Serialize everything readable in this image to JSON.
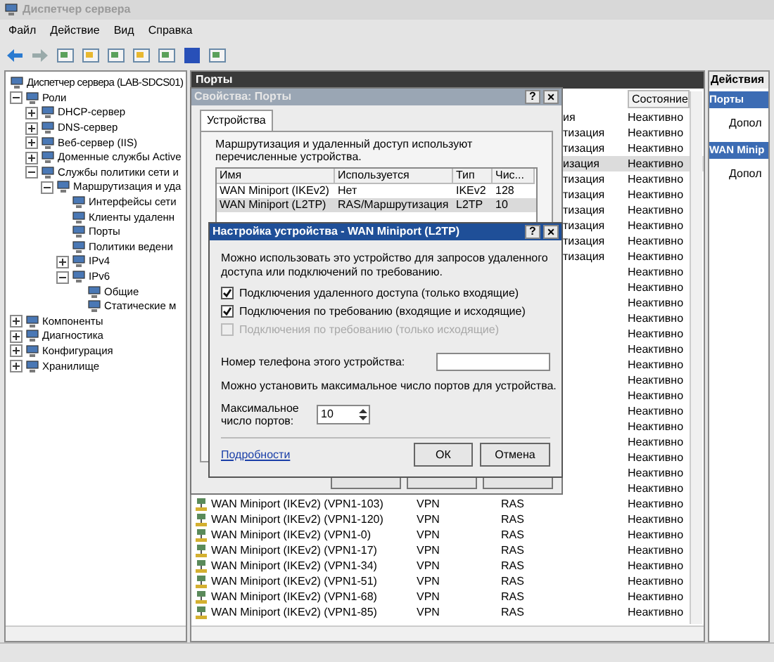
{
  "window": {
    "title": "Диспетчер сервера"
  },
  "menu": [
    "Файл",
    "Действие",
    "Вид",
    "Справка"
  ],
  "tree": [
    {
      "label": "Диспетчер сервера (LAB-SDCS01)"
    },
    {
      "label": "Роли",
      "expanded": true,
      "children": [
        {
          "label": "DHCP-сервер",
          "expanded": false
        },
        {
          "label": "DNS-сервер",
          "expanded": false
        },
        {
          "label": "Веб-сервер (IIS)",
          "expanded": false
        },
        {
          "label": "Доменные службы Active",
          "expanded": false
        },
        {
          "label": "Службы политики сети и",
          "expanded": true,
          "children": [
            {
              "label": "Маршрутизация и уда",
              "expanded": true,
              "children": [
                {
                  "label": "Интерфейсы сети"
                },
                {
                  "label": "Клиенты удаленн"
                },
                {
                  "label": "Порты"
                },
                {
                  "label": "Политики ведени"
                },
                {
                  "label": "IPv4",
                  "expanded": false
                },
                {
                  "label": "IPv6",
                  "expanded": true,
                  "children": [
                    {
                      "label": "Общие"
                    },
                    {
                      "label": "Статические м"
                    }
                  ]
                }
              ]
            }
          ]
        }
      ]
    },
    {
      "label": "Компоненты",
      "expanded": false
    },
    {
      "label": "Диагностика",
      "expanded": false
    },
    {
      "label": "Конфигурация",
      "expanded": false
    },
    {
      "label": "Хранилище",
      "expanded": false
    }
  ],
  "content": {
    "title": "Порты",
    "status_header": "Состояние",
    "rows": [
      {
        "kind": "partial",
        "column_3": "ия",
        "status": "Неактивно",
        "selected": false
      },
      {
        "kind": "partial",
        "column_3": "тизация",
        "status": "Неактивно",
        "selected": false
      },
      {
        "kind": "partial",
        "column_3": "тизация",
        "status": "Неактивно",
        "selected": false
      },
      {
        "kind": "partial",
        "column_3": "изация",
        "status": "Неактивно",
        "selected": true
      },
      {
        "kind": "partial",
        "column_3": "тизация",
        "status": "Неактивно",
        "selected": false
      },
      {
        "kind": "partial",
        "column_3": "тизация",
        "status": "Неактивно",
        "selected": false
      },
      {
        "kind": "partial",
        "column_3": "тизация",
        "status": "Неактивно",
        "selected": false
      },
      {
        "kind": "partial",
        "column_3": "тизация",
        "status": "Неактивно",
        "selected": false
      },
      {
        "kind": "partial",
        "column_3": "тизация",
        "status": "Неактивно",
        "selected": false
      },
      {
        "kind": "partial",
        "column_3": "тизация",
        "status": "Неактивно",
        "selected": false
      },
      {
        "kind": "status",
        "status": "Неактивно",
        "selected": false
      },
      {
        "kind": "status",
        "status": "Неактивно",
        "selected": false
      },
      {
        "kind": "status",
        "status": "Неактивно",
        "selected": false
      },
      {
        "kind": "status",
        "status": "Неактивно",
        "selected": false
      },
      {
        "kind": "status",
        "status": "Неактивно",
        "selected": false
      },
      {
        "kind": "status",
        "status": "Неактивно",
        "selected": false
      },
      {
        "kind": "status",
        "status": "Неактивно",
        "selected": false
      },
      {
        "kind": "status",
        "status": "Неактивно",
        "selected": false
      },
      {
        "kind": "status",
        "status": "Неактивно",
        "selected": false
      },
      {
        "kind": "status",
        "status": "Неактивно",
        "selected": false
      },
      {
        "kind": "status",
        "status": "Неактивно",
        "selected": false
      },
      {
        "kind": "status",
        "status": "Неактивно",
        "selected": false
      },
      {
        "kind": "status",
        "status": "Неактивно",
        "selected": false
      },
      {
        "kind": "status",
        "status": "Неактивно",
        "selected": false
      },
      {
        "kind": "status",
        "status": "Неактивно",
        "selected": false
      },
      {
        "kind": "full",
        "name": "WAN Miniport (IKEv2) (VPN1-103)",
        "column_2": "VPN",
        "column_3": "RAS",
        "status": "Неактивно",
        "selected": false
      },
      {
        "kind": "full",
        "name": "WAN Miniport (IKEv2) (VPN1-120)",
        "column_2": "VPN",
        "column_3": "RAS",
        "status": "Неактивно",
        "selected": false
      },
      {
        "kind": "full",
        "name": "WAN Miniport (IKEv2) (VPN1-0)",
        "column_2": "VPN",
        "column_3": "RAS",
        "status": "Неактивно",
        "selected": false
      },
      {
        "kind": "full",
        "name": "WAN Miniport (IKEv2) (VPN1-17)",
        "column_2": "VPN",
        "column_3": "RAS",
        "status": "Неактивно",
        "selected": false
      },
      {
        "kind": "full",
        "name": "WAN Miniport (IKEv2) (VPN1-34)",
        "column_2": "VPN",
        "column_3": "RAS",
        "status": "Неактивно",
        "selected": false
      },
      {
        "kind": "full",
        "name": "WAN Miniport (IKEv2) (VPN1-51)",
        "column_2": "VPN",
        "column_3": "RAS",
        "status": "Неактивно",
        "selected": false
      },
      {
        "kind": "full",
        "name": "WAN Miniport (IKEv2) (VPN1-68)",
        "column_2": "VPN",
        "column_3": "RAS",
        "status": "Неактивно",
        "selected": false
      },
      {
        "kind": "full",
        "name": "WAN Miniport (IKEv2) (VPN1-85)",
        "column_2": "VPN",
        "column_3": "RAS",
        "status": "Неактивно",
        "selected": false
      }
    ]
  },
  "actions": {
    "title": "Действия",
    "sections": [
      {
        "title": "Порты",
        "item": "Допол"
      },
      {
        "title": "WAN Minip",
        "item": "Допол"
      }
    ]
  },
  "properties_dialog": {
    "title": "Свойства: Порты",
    "help": "?",
    "close": "×",
    "tab": "Устройства",
    "description": "Маршрутизация и удаленный доступ используют перечисленные устройства.",
    "columns": [
      "Имя",
      "Используется",
      "Тип",
      "Чис..."
    ],
    "rows": [
      {
        "cells": [
          "WAN Miniport (IKEv2)",
          "Нет",
          "IKEv2",
          "128"
        ],
        "selected": false
      },
      {
        "cells": [
          "WAN Miniport (L2TP)",
          "RAS/Маршрутизация",
          "L2TP",
          "10"
        ],
        "selected": true
      }
    ]
  },
  "device_dialog": {
    "title": "Настройка устройства - WAN Miniport (L2TP)",
    "help": "?",
    "close": "×",
    "description": "Можно использовать это устройство для запросов удаленного доступа или подключений по требованию.",
    "options": [
      {
        "label": "Подключения удаленного доступа (только входящие)",
        "checked": true,
        "disabled": false
      },
      {
        "label": "Подключения по требованию (входящие и исходящие)",
        "checked": true,
        "disabled": false
      },
      {
        "label": "Подключения по требованию (только исходящие)",
        "checked": false,
        "disabled": true
      }
    ],
    "phone_label": "Номер телефона этого устройства:",
    "ports_note": "Можно установить максимальное число портов для устройства.",
    "max_ports_label": "Максимальное число портов:",
    "max_ports": "10",
    "link": "Подробности",
    "buttons": [
      "ОК",
      "Отмена"
    ]
  }
}
